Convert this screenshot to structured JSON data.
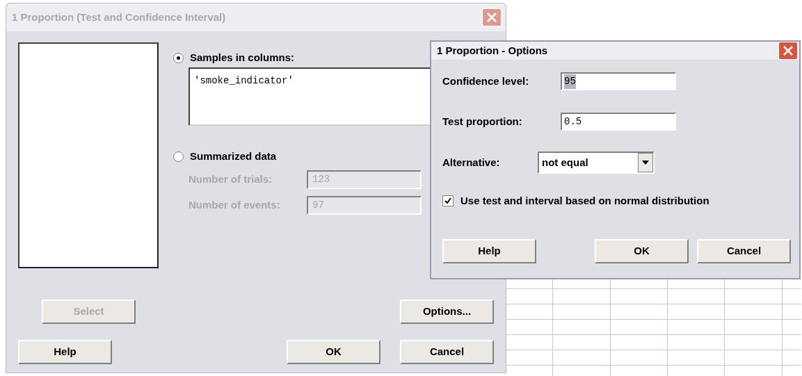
{
  "main_dialog": {
    "title": "1 Proportion (Test and Confidence Interval)",
    "active": false,
    "sources": [
      {
        "kind": "columns",
        "label": "Samples in columns:",
        "selected": true,
        "value": "'smoke_indicator'"
      },
      {
        "kind": "summarized",
        "label": "Summarized data",
        "selected": false,
        "fields": [
          {
            "label": "Number of trials:",
            "value": "123",
            "disabled": true
          },
          {
            "label": "Number of events:",
            "value": "97",
            "disabled": true
          }
        ]
      }
    ],
    "buttons": [
      {
        "label": "Select",
        "disabled": true
      },
      {
        "label": "Options...",
        "disabled": false
      },
      {
        "label": "Help",
        "disabled": false
      },
      {
        "label": "OK",
        "disabled": false
      },
      {
        "label": "Cancel",
        "disabled": false
      }
    ]
  },
  "options_dialog": {
    "title": "1 Proportion - Options",
    "active": true,
    "fields": [
      {
        "label": "Confidence level:",
        "value": "95",
        "text_selected": true
      },
      {
        "label": "Test proportion:",
        "value": "0.5",
        "text_selected": false
      }
    ],
    "alternative": {
      "label": "Alternative:",
      "value": "not equal"
    },
    "normal_checkbox": {
      "label": "Use test and interval based on normal distribution",
      "checked": true
    },
    "buttons": [
      {
        "label": "Help",
        "disabled": false
      },
      {
        "label": "OK",
        "disabled": false
      },
      {
        "label": "Cancel",
        "disabled": false
      }
    ]
  }
}
